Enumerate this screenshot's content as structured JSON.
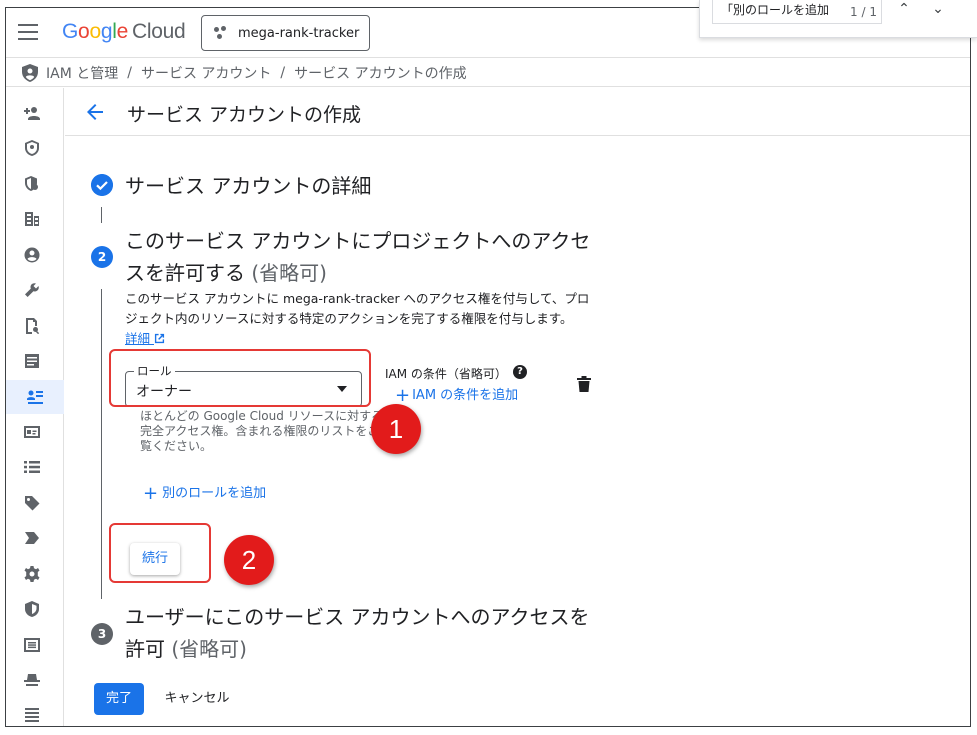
{
  "topbar": {
    "logo": "Google",
    "product": "Cloud",
    "project_name": "mega-rank-tracker"
  },
  "findbar": {
    "query": "「別のロールを追加",
    "count": "1 / 1"
  },
  "breadcrumb": {
    "items": [
      "IAM と管理",
      "サービス アカウント",
      "サービス アカウントの作成"
    ],
    "separator": "/"
  },
  "page": {
    "title": "サービス アカウントの作成"
  },
  "steps": {
    "step1": {
      "title": "サービス アカウントの詳細"
    },
    "step2": {
      "number": "2",
      "title": "このサービス アカウントにプロジェクトへのアクセスを許可する",
      "optional": "(省略可)",
      "description": "このサービス アカウントに mega-rank-tracker へのアクセス権を付与して、プロジェクト内のリソースに対する特定のアクションを完了する権限を付与します。",
      "learn_more": "詳細"
    },
    "step3": {
      "number": "3",
      "title": "ユーザーにこのサービス アカウントへのアクセスを許可",
      "optional": "(省略可)"
    }
  },
  "role": {
    "label": "ロール",
    "value": "オーナー",
    "help": "ほとんどの Google Cloud リソースに対する完全アクセス権。含まれる権限のリストをご覧ください。"
  },
  "condition": {
    "label": "IAM の条件（省略可）",
    "help_icon": "?",
    "add_label": "IAM の条件を追加"
  },
  "actions": {
    "add_role": "別のロールを追加",
    "continue": "続行",
    "done": "完了",
    "cancel": "キャンセル"
  },
  "annotations": {
    "badge1": "1",
    "badge2": "2",
    "color": "#e21b1b"
  },
  "colors": {
    "accent": "#1a73e8",
    "text": "#202124",
    "muted": "#5f6368"
  }
}
